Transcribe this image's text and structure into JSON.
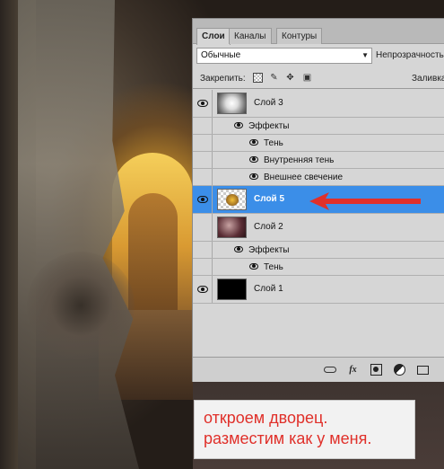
{
  "panel": {
    "tabs": [
      {
        "label": "Слои",
        "active": true
      },
      {
        "label": "Каналы",
        "active": false
      },
      {
        "label": "Контуры",
        "active": false
      }
    ],
    "blend_mode": "Обычные",
    "opacity_label": "Непрозрачность",
    "lock_label": "Закрепить:",
    "fill_label": "Заливка",
    "layers": [
      {
        "name": "Слой 3",
        "selected": false
      },
      {
        "name": "Слой 5",
        "selected": true
      },
      {
        "name": "Слой 2",
        "selected": false
      },
      {
        "name": "Слой 1",
        "selected": false
      }
    ],
    "effects_label": "Эффекты",
    "layer3_effects": [
      "Тень",
      "Внутренняя тень",
      "Внешнее свечение"
    ],
    "layer2_effects": [
      "Тень"
    ],
    "accent_color": "#3b8ee8"
  },
  "caption": {
    "line1": "откроем дворец.",
    "line2": "разместим как у меня.",
    "color": "#e0302a"
  },
  "icons": [
    "eye-icon",
    "lock-transparent-icon",
    "brush-icon",
    "move-icon",
    "lock-icon",
    "link-icon",
    "fx-icon",
    "mask-icon",
    "adjustment-icon",
    "folder-icon",
    "arrow-icon"
  ]
}
